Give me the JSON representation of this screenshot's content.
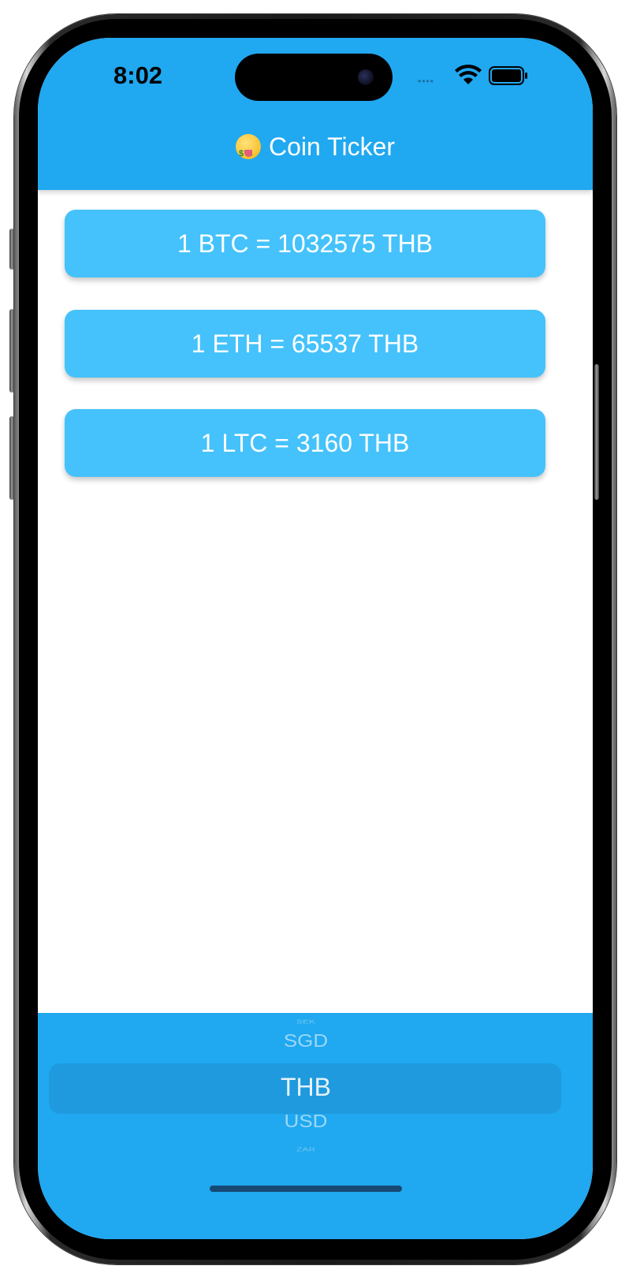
{
  "status_bar": {
    "time": "8:02",
    "signal": "••••"
  },
  "app_bar": {
    "emoji_icon": "money-mouth-face-icon",
    "title": "Coin Ticker",
    "background": "#20a8f0"
  },
  "rates": [
    {
      "text": "1 BTC = 1032575 THB"
    },
    {
      "text": "1 ETH = 65537 THB"
    },
    {
      "text": "1 LTC = 3160 THB"
    }
  ],
  "currency_picker": {
    "items": [
      "SEK",
      "SGD",
      "THB",
      "USD",
      "ZAR"
    ],
    "selected": "THB"
  },
  "colors": {
    "card_background": "#45c2fb",
    "accent": "#20a8f0"
  }
}
